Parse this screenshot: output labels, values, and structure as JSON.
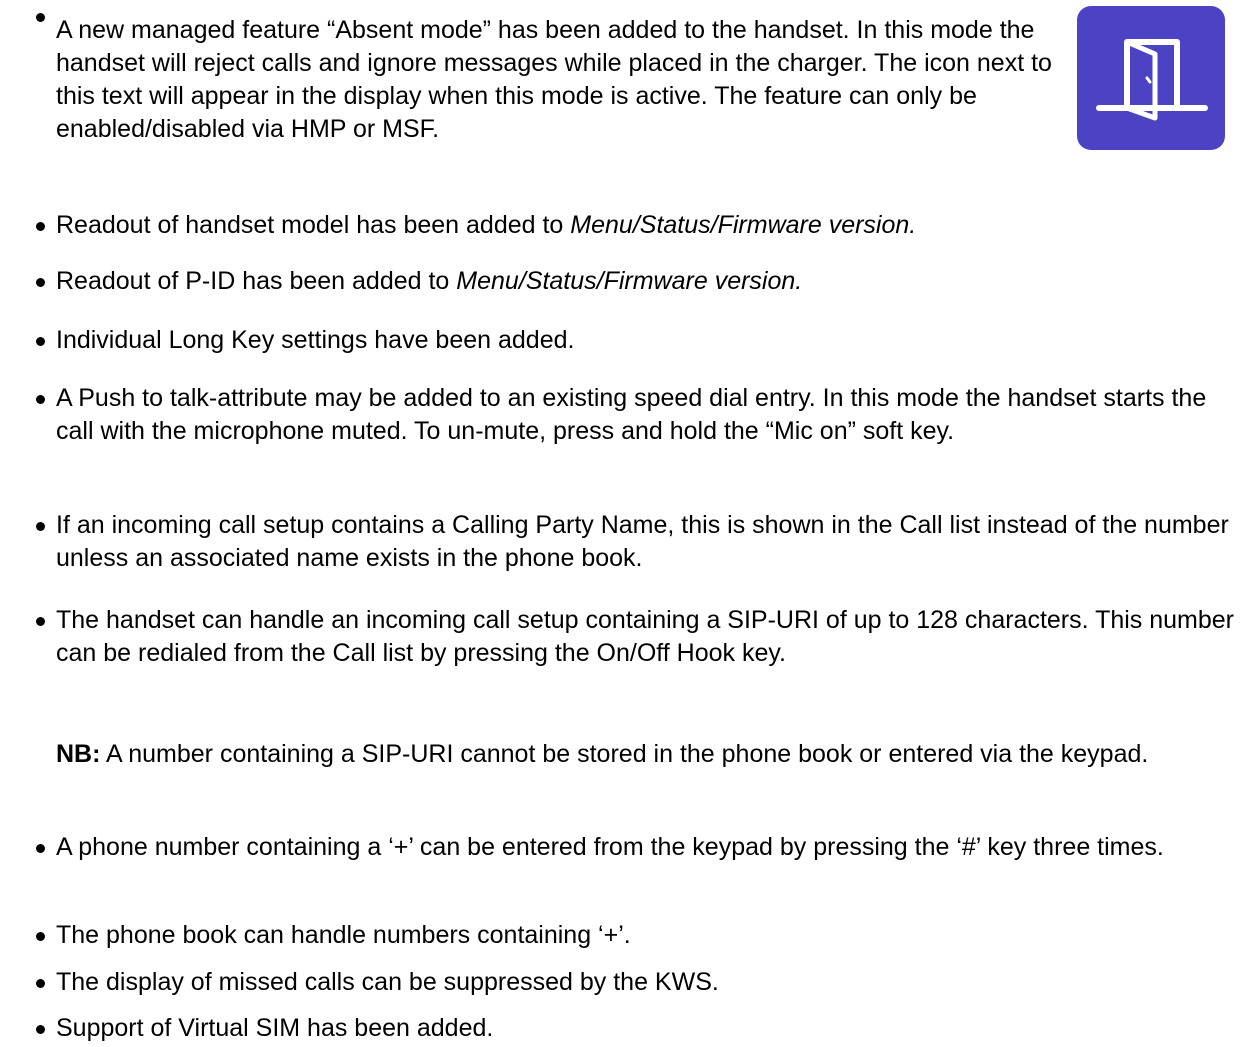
{
  "icon": {
    "name": "door-icon",
    "background": "#4b43c4",
    "foreground": "#ffffff"
  },
  "items": [
    {
      "text": "A new managed feature “Absent mode” has been added to the handset. In this mode the handset will reject calls and ignore messages while placed in the charger. The icon next to this text will appear in the display when this mode is active. The feature can only be enabled/disabled via HMP or MSF."
    },
    {
      "text_plain": "Readout of handset model has been added to ",
      "text_italic": "Menu/Status/Firmware version."
    },
    {
      "text_plain": "Readout of P-ID has been added to ",
      "text_italic": "Menu/Status/Firmware version."
    },
    {
      "text": "Individual Long Key settings have been added."
    },
    {
      "text": "A Push to talk-attribute may be added to an existing speed dial entry. In this mode the handset starts the call with the microphone muted. To un-mute, press and hold the “Mic on” soft key."
    },
    {
      "text": "If an incoming call setup contains a Calling Party Name, this is shown in the Call list instead of the number unless an associated name exists in the phone book."
    },
    {
      "text": "The handset can handle an incoming call setup containing a SIP-URI of up to 128 characters. This number can be redialed from the Call list by pressing the On/Off Hook key.",
      "note_label": "NB:",
      "note_text": " A number containing a SIP-URI cannot be stored in the phone book or entered via the keypad."
    },
    {
      "text": "A phone number containing a ‘+’ can be entered from the keypad by pressing the ‘#’ key three times."
    },
    {
      "text": "The phone book can handle numbers containing ‘+’."
    },
    {
      "text": "The display of missed calls can be suppressed by the KWS."
    },
    {
      "text": "Support of Virtual SIM has been added."
    }
  ]
}
